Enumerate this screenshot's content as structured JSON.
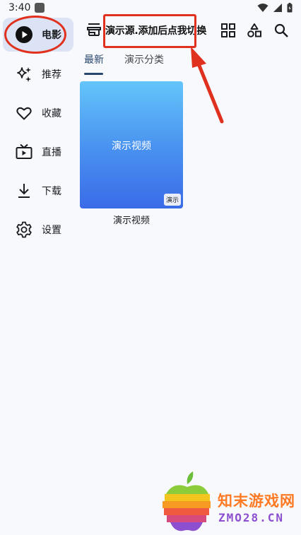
{
  "status_bar": {
    "time": "3:40"
  },
  "rail": {
    "items": [
      {
        "label": "电影",
        "icon": "play-circle-icon",
        "active": true
      },
      {
        "label": "推荐",
        "icon": "sparkle-icon",
        "active": false
      },
      {
        "label": "收藏",
        "icon": "heart-icon",
        "active": false
      },
      {
        "label": "直播",
        "icon": "tv-icon",
        "active": false
      },
      {
        "label": "下载",
        "icon": "download-icon",
        "active": false
      },
      {
        "label": "设置",
        "icon": "gear-icon",
        "active": false
      }
    ]
  },
  "topbar": {
    "source_title": "演示源.添加后点我切换",
    "actions": [
      "grid-icon",
      "category-icon",
      "search-icon"
    ]
  },
  "tabs": [
    {
      "label": "最新",
      "active": true
    },
    {
      "label": "演示分类",
      "active": false
    }
  ],
  "content": {
    "cards": [
      {
        "poster_text": "演示视频",
        "badge": "演示",
        "title": "演示视频"
      }
    ]
  },
  "watermark": {
    "cn": "知末游戏网",
    "en": "ZMO28.CN"
  },
  "colors": {
    "accent": "#28466e",
    "active_bg": "#dbe3f4",
    "annotation_red": "#e0301e",
    "background": "#f8f9fc"
  }
}
